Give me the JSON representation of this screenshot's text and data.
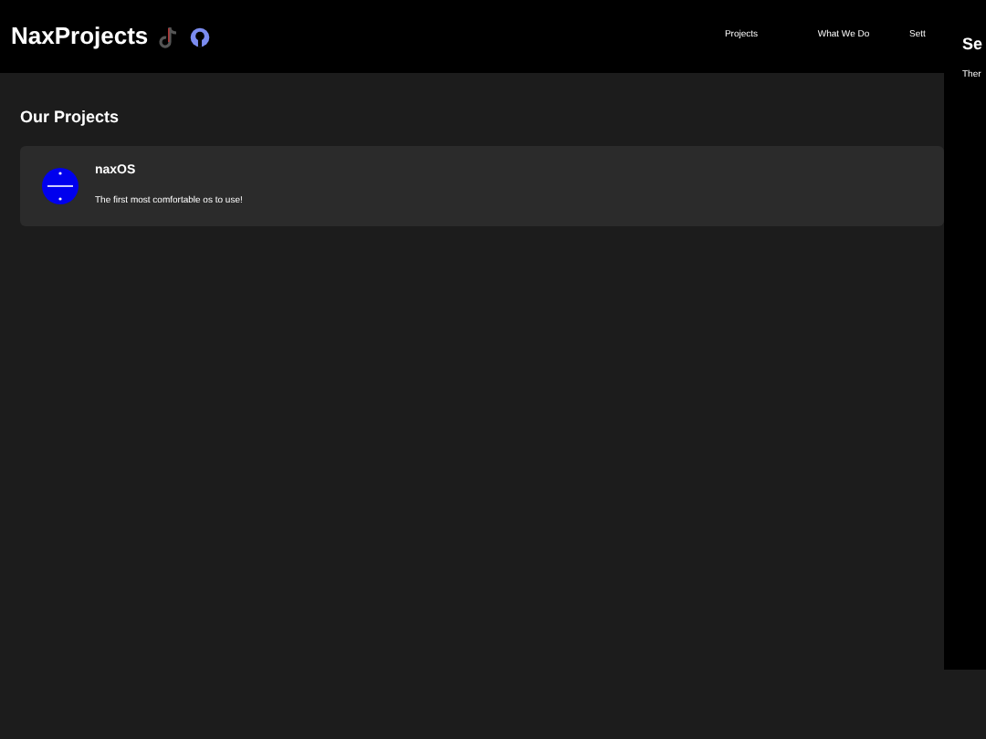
{
  "header": {
    "brand": "NaxProjects",
    "nav": [
      {
        "label": "Projects"
      },
      {
        "label": "What We Do"
      },
      {
        "label": "Sett"
      }
    ]
  },
  "projects": {
    "title": "Our Projects",
    "items": [
      {
        "name": "naxOS",
        "description": "The first most comfortable os to use!"
      }
    ]
  },
  "settings_panel": {
    "title": "Se",
    "text": "Ther"
  }
}
